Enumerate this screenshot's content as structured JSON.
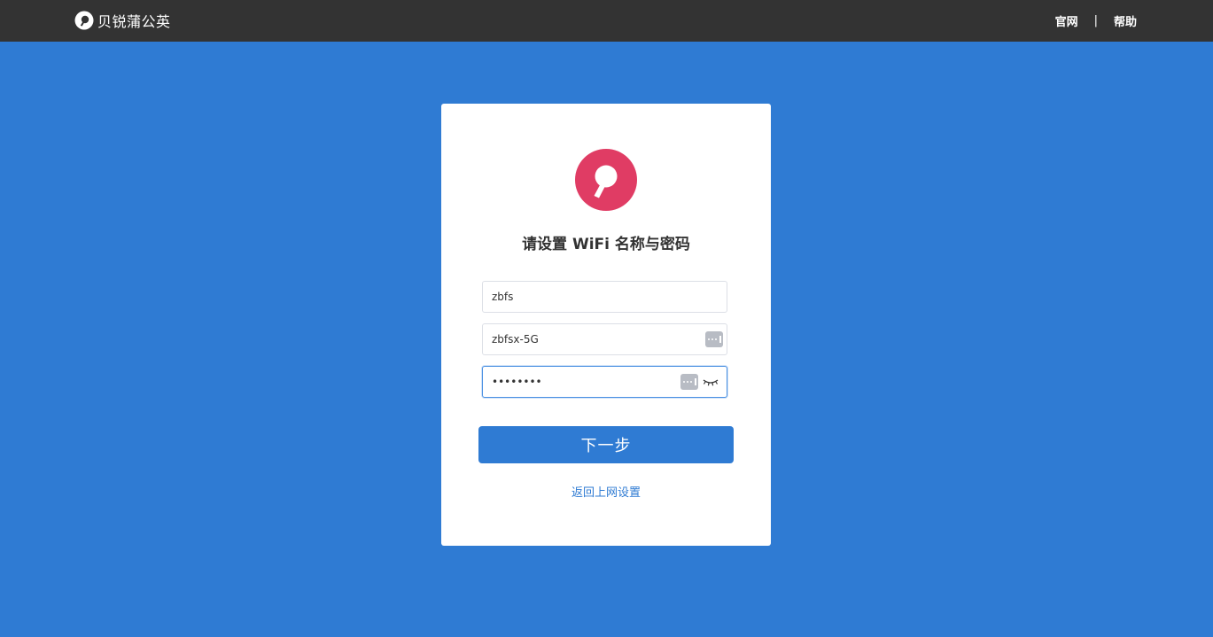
{
  "header": {
    "brand_name": "贝锐蒲公英",
    "nav": {
      "official_site": "官网",
      "separator": "|",
      "help": "帮助"
    }
  },
  "card": {
    "title": "请设置 WiFi 名称与密码",
    "fields": {
      "wifi_name_24g": {
        "value": "zbfs"
      },
      "wifi_name_5g": {
        "value": "zbfsx-5G"
      },
      "wifi_password": {
        "value": "••••••••"
      }
    },
    "next_button": "下一步",
    "back_link": "返回上网设置"
  },
  "colors": {
    "background": "#2f7bd3",
    "topbar": "#333333",
    "logo": "#e03c64",
    "button": "#2f7bd3",
    "link": "#2f7bd3"
  }
}
